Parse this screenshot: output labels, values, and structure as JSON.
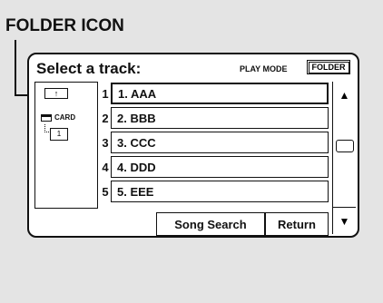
{
  "callout": {
    "label": "FOLDER ICON"
  },
  "screen": {
    "title": "Select a track:",
    "play_mode_label": "PLAY MODE",
    "folder_button_label": "FOLDER"
  },
  "tree": {
    "up_folder_icon": "folder-up-icon",
    "card_label": "CARD",
    "folder_number": "1"
  },
  "tracks": [
    {
      "num": "1",
      "name": "1. AAA"
    },
    {
      "num": "2",
      "name": "2. BBB"
    },
    {
      "num": "3",
      "name": "3. CCC"
    },
    {
      "num": "4",
      "name": "4. DDD"
    },
    {
      "num": "5",
      "name": "5. EEE"
    }
  ],
  "scroll": {
    "up": "▲",
    "down": "▼"
  },
  "buttons": {
    "song_search": "Song Search",
    "return": "Return"
  }
}
